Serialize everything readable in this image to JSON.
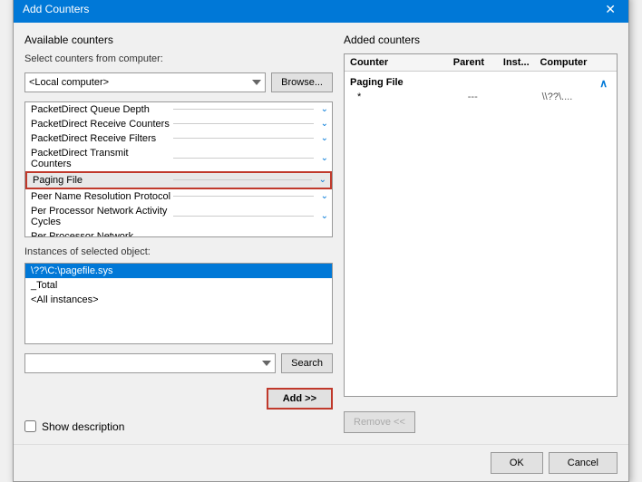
{
  "dialog": {
    "title": "Add Counters",
    "close_label": "✕"
  },
  "left": {
    "available_counters_label": "Available counters",
    "select_from_label": "Select counters from computer:",
    "computer_value": "<Local computer>",
    "browse_label": "Browse...",
    "counters": [
      {
        "name": "PacketDirect Queue Depth",
        "has_arrow": true
      },
      {
        "name": "PacketDirect Receive Counters",
        "has_arrow": true
      },
      {
        "name": "PacketDirect Receive Filters",
        "has_arrow": true
      },
      {
        "name": "PacketDirect Transmit Counters",
        "has_arrow": true
      },
      {
        "name": "Paging File",
        "has_arrow": true,
        "selected": true
      },
      {
        "name": "Peer Name Resolution Protocol",
        "has_arrow": true
      },
      {
        "name": "Per Processor Network Activity Cycles",
        "has_arrow": true
      },
      {
        "name": "Per Processor Network Interface Card Activity",
        "has_arrow": true
      }
    ],
    "instances_label": "Instances of selected object:",
    "instances": [
      {
        "name": "\\??\\C:\\pagefile.sys",
        "selected": true
      },
      {
        "name": "_Total",
        "selected": false
      },
      {
        "name": "<All instances>",
        "selected": false
      }
    ],
    "search_placeholder": "",
    "search_label": "Search",
    "add_label": "Add >>",
    "show_description_label": "Show description"
  },
  "right": {
    "added_counters_label": "Added counters",
    "columns": {
      "counter": "Counter",
      "parent": "Parent",
      "inst": "Inst...",
      "computer": "Computer"
    },
    "groups": [
      {
        "name": "Paging File",
        "rows": [
          {
            "counter": "*",
            "parent": "---",
            "inst": "",
            "computer": "\\\\??\\...."
          }
        ]
      }
    ],
    "remove_label": "Remove <<"
  },
  "footer": {
    "ok_label": "OK",
    "cancel_label": "Cancel"
  }
}
